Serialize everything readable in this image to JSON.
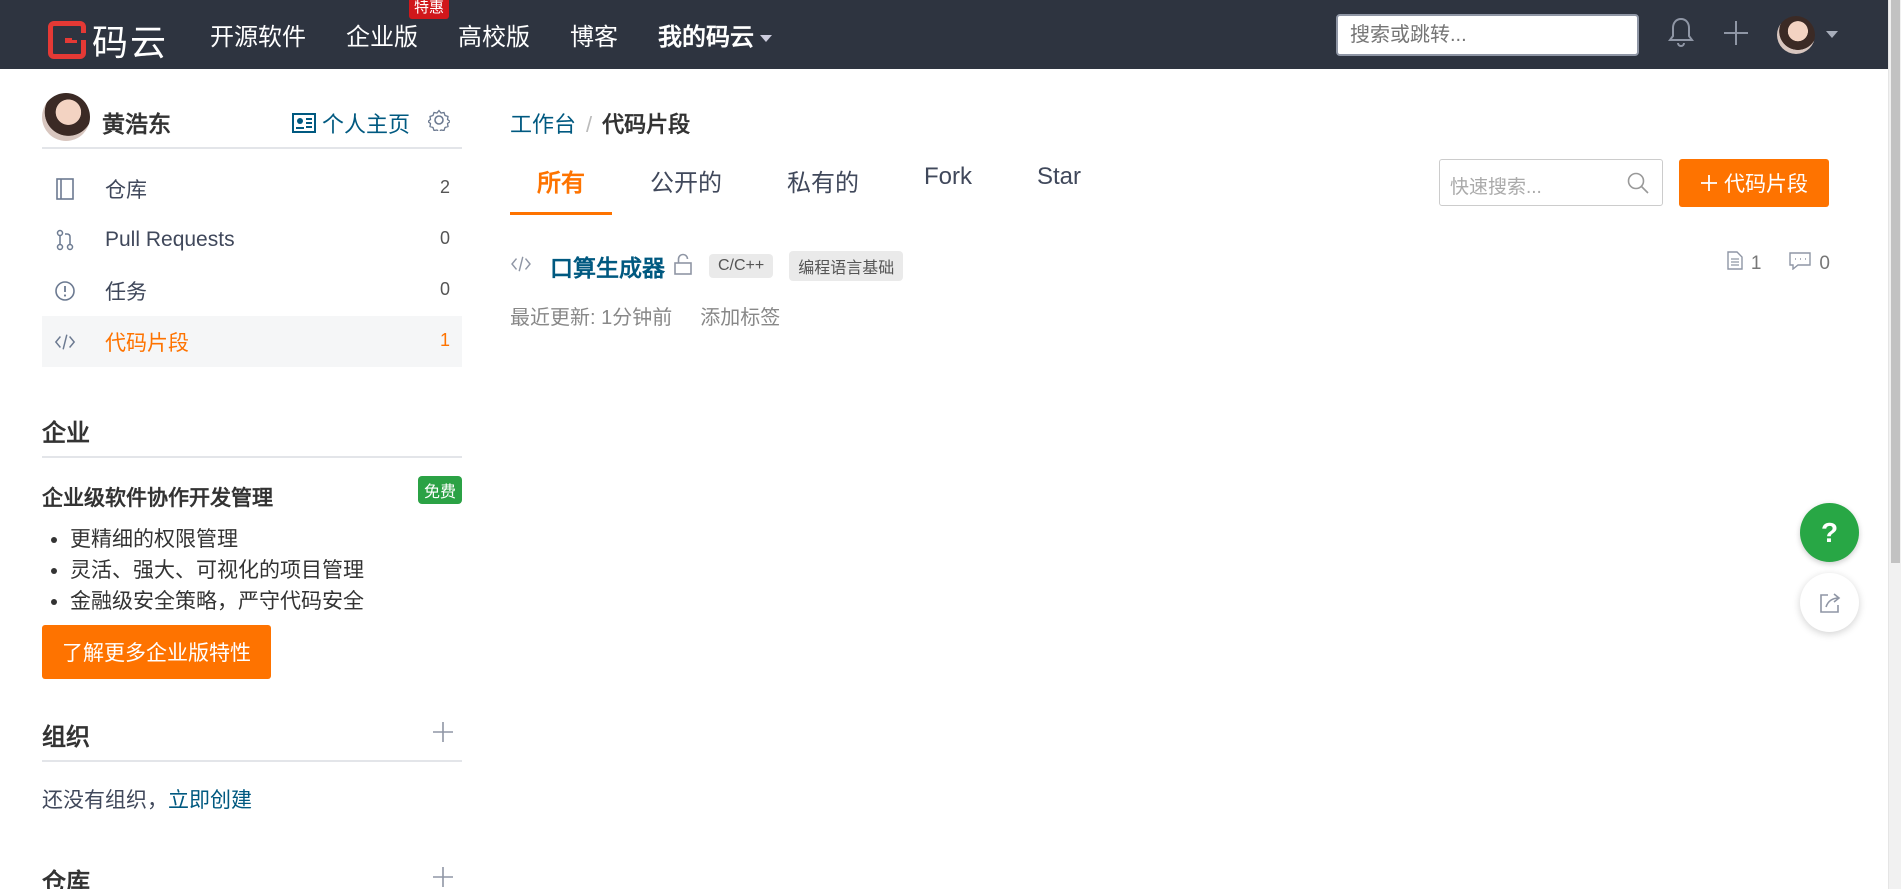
{
  "brand": {
    "logo_text": "码云"
  },
  "nav": {
    "items": [
      {
        "label": "开源软件"
      },
      {
        "label": "企业版",
        "badge": "特惠"
      },
      {
        "label": "高校版"
      },
      {
        "label": "博客"
      },
      {
        "label": "我的码云"
      }
    ],
    "search_placeholder": "搜索或跳转..."
  },
  "profile": {
    "name": "黄浩东",
    "homepage_label": "个人主页"
  },
  "menu": [
    {
      "icon": "repository-icon",
      "label": "仓库",
      "count": "2"
    },
    {
      "icon": "pull-request-icon",
      "label": "Pull Requests",
      "count": "0"
    },
    {
      "icon": "issue-icon",
      "label": "任务",
      "count": "0"
    },
    {
      "icon": "code-icon",
      "label": "代码片段",
      "count": "1",
      "active": true
    }
  ],
  "enterprise": {
    "section_title": "企业",
    "heading": "企业级软件协作开发管理",
    "badge": "免费",
    "bullets": [
      "更精细的权限管理",
      "灵活、强大、可视化的项目管理",
      "金融级安全策略，严守代码安全"
    ],
    "cta": "了解更多企业版特性"
  },
  "organization": {
    "section_title": "组织",
    "empty_text": "还没有组织，",
    "create_link": "立即创建"
  },
  "repos_section": {
    "section_title": "仓库"
  },
  "breadcrumb": {
    "root": "工作台",
    "sep": "/",
    "current": "代码片段"
  },
  "tabs": [
    {
      "label": "所有",
      "active": true
    },
    {
      "label": "公开的"
    },
    {
      "label": "私有的"
    },
    {
      "label": "Fork"
    },
    {
      "label": "Star"
    }
  ],
  "quick_search": {
    "placeholder": "快速搜索..."
  },
  "add_snippet_button": "代码片段",
  "snippets": [
    {
      "title": "口算生成器",
      "tags": [
        "C/C++",
        "编程语言基础"
      ],
      "files_count": "1",
      "comments_count": "0",
      "updated": "最近更新: 1分钟前",
      "add_tag": "添加标签"
    }
  ],
  "help_button": "?",
  "colors": {
    "accent": "#fe7300",
    "nav_bg": "#2e3440",
    "link": "#005980",
    "success": "#28a745"
  }
}
